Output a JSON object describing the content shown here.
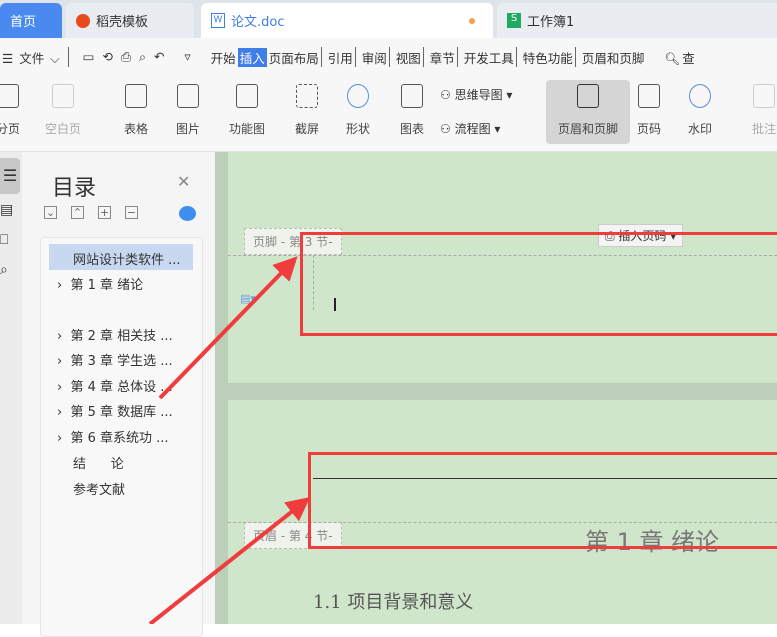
{
  "tabs": [
    {
      "label": "首页"
    },
    {
      "label": "稻壳模板"
    },
    {
      "label": "论文.doc"
    },
    {
      "label": "工作簿1"
    }
  ],
  "menu": {
    "file": "文件",
    "items": [
      "开始",
      "插入",
      "页面布局",
      "引用",
      "审阅",
      "视图",
      "章节",
      "开发工具",
      "特色功能",
      "页眉和页脚"
    ],
    "active": "插入",
    "search": "查"
  },
  "ribbon": [
    "分页",
    "空白页",
    "表格",
    "图片",
    "功能图",
    "截屏",
    "形状",
    "图表",
    "页眉和页脚",
    "页码",
    "水印",
    "批注"
  ],
  "ribbon_small": [
    "思维导图",
    "流程图"
  ],
  "toc": {
    "title": "目录",
    "items": [
      "网站设计类软件 ...",
      "第 1 章  绪论",
      "第 2 章  相关技 ...",
      "第 3 章  学生选 ...",
      "第 4 章  总体设 ...",
      "第 5 章  数据库 ...",
      "第 6 章系统功 ...",
      "结      论",
      "参考文献"
    ]
  },
  "doc": {
    "footer_label": "页脚  - 第 3 节-",
    "insert_page_num": "插入页码",
    "header_label": "页眉  - 第 4 节-",
    "chapter_title": "第 1 章  绪论",
    "section_title": "1.1  项目背景和意义"
  },
  "colors": {
    "accent": "#3f7de8",
    "annotation": "#f03c3c",
    "page_bg": "#cfe6cb"
  }
}
